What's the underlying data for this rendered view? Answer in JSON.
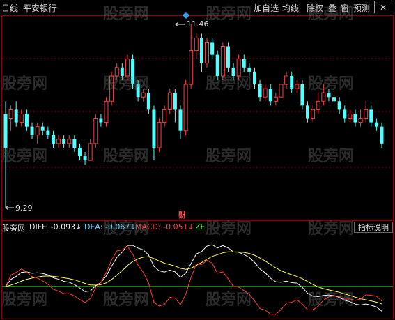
{
  "toolbar": {
    "period": "日线",
    "stock_name": "平安银行",
    "buttons": [
      "加自选",
      "均线",
      "除权",
      "叠",
      "窗",
      "预测"
    ]
  },
  "watermark": "股旁网",
  "chart": {
    "high_label": "11.46",
    "low_label": "9.29",
    "fin_marker": "财"
  },
  "macd": {
    "title": "股旁网",
    "diff": "DIFF: -0.093↓",
    "dea": "DEA: -0.067↓",
    "macd": "MACD: -0.051↓",
    "ze": "ZE",
    "help_label": "指标说明"
  },
  "colors": {
    "up": "#ff3c3c",
    "down": "#54ffff",
    "diff": "#ffffff",
    "dea": "#ffff54",
    "ze": "#ff3c3c",
    "zero": "#40ff40",
    "grid": "#8b0000"
  },
  "chart_data": {
    "type": "candlestick",
    "price_high": 11.46,
    "price_low": 9.29,
    "candles": [
      [
        10.4,
        10.0,
        10.55,
        9.29
      ],
      [
        10.35,
        10.45,
        10.5,
        10.2
      ],
      [
        10.45,
        10.3,
        10.55,
        10.25
      ],
      [
        10.3,
        10.4,
        10.45,
        10.25
      ],
      [
        10.4,
        10.25,
        10.45,
        10.2
      ],
      [
        10.25,
        10.15,
        10.3,
        10.1
      ],
      [
        10.15,
        10.25,
        10.3,
        10.05
      ],
      [
        10.25,
        10.2,
        10.3,
        10.15
      ],
      [
        10.2,
        10.15,
        10.25,
        10.1
      ],
      [
        10.15,
        10.05,
        10.2,
        10.0
      ],
      [
        10.05,
        10.1,
        10.15,
        10.0
      ],
      [
        10.1,
        10.05,
        10.15,
        10.0
      ],
      [
        10.05,
        10.1,
        10.15,
        10.0
      ],
      [
        10.1,
        10.0,
        10.15,
        9.95
      ],
      [
        10.0,
        9.9,
        10.05,
        9.85
      ],
      [
        9.9,
        9.85,
        9.95,
        9.8
      ],
      [
        9.85,
        10.05,
        10.1,
        9.85
      ],
      [
        10.05,
        10.35,
        10.4,
        10.0
      ],
      [
        10.35,
        10.3,
        10.4,
        10.25
      ],
      [
        10.3,
        10.55,
        10.6,
        10.25
      ],
      [
        10.55,
        10.85,
        10.9,
        10.5
      ],
      [
        10.85,
        10.95,
        11.0,
        10.8
      ],
      [
        10.95,
        10.85,
        11.0,
        10.8
      ],
      [
        10.85,
        11.05,
        11.1,
        10.8
      ],
      [
        11.05,
        10.75,
        11.1,
        10.7
      ],
      [
        10.75,
        10.6,
        10.8,
        10.55
      ],
      [
        10.6,
        10.65,
        10.7,
        10.55
      ],
      [
        10.65,
        10.45,
        10.7,
        10.4
      ],
      [
        10.45,
        10.0,
        10.5,
        9.85
      ],
      [
        10.0,
        10.3,
        10.35,
        9.95
      ],
      [
        10.3,
        10.45,
        10.5,
        10.25
      ],
      [
        10.45,
        10.65,
        10.7,
        10.4
      ],
      [
        10.65,
        10.45,
        10.7,
        10.3
      ],
      [
        10.45,
        10.2,
        10.5,
        10.1
      ],
      [
        10.2,
        10.75,
        10.8,
        10.15
      ],
      [
        10.75,
        11.15,
        11.46,
        10.7
      ],
      [
        11.15,
        11.3,
        11.35,
        11.05
      ],
      [
        11.3,
        11.0,
        11.35,
        10.9
      ],
      [
        11.0,
        11.25,
        11.3,
        10.95
      ],
      [
        11.25,
        11.1,
        11.3,
        11.05
      ],
      [
        11.1,
        10.85,
        11.15,
        10.8
      ],
      [
        10.85,
        11.2,
        11.25,
        10.8
      ],
      [
        11.2,
        10.95,
        11.25,
        10.9
      ],
      [
        10.95,
        10.85,
        11.0,
        10.8
      ],
      [
        10.85,
        11.05,
        11.1,
        10.8
      ],
      [
        11.05,
        10.95,
        11.1,
        10.9
      ],
      [
        10.95,
        10.9,
        11.0,
        10.85
      ],
      [
        10.9,
        10.75,
        10.95,
        10.7
      ],
      [
        10.75,
        10.6,
        10.8,
        10.55
      ],
      [
        10.6,
        10.7,
        10.75,
        10.55
      ],
      [
        10.7,
        10.55,
        10.75,
        10.5
      ],
      [
        10.55,
        10.6,
        10.65,
        10.5
      ],
      [
        10.6,
        10.75,
        10.8,
        10.55
      ],
      [
        10.75,
        10.85,
        10.9,
        10.7
      ],
      [
        10.85,
        10.7,
        10.9,
        10.65
      ],
      [
        10.7,
        10.75,
        10.8,
        10.65
      ],
      [
        10.75,
        10.5,
        10.8,
        10.45
      ],
      [
        10.5,
        10.35,
        10.55,
        10.3
      ],
      [
        10.35,
        10.45,
        10.5,
        10.3
      ],
      [
        10.45,
        10.55,
        10.65,
        10.4
      ],
      [
        10.55,
        10.65,
        10.75,
        10.5
      ],
      [
        10.65,
        10.6,
        10.7,
        10.55
      ],
      [
        10.6,
        10.55,
        10.65,
        10.5
      ],
      [
        10.55,
        10.45,
        10.6,
        10.4
      ],
      [
        10.45,
        10.35,
        10.5,
        10.3
      ],
      [
        10.35,
        10.4,
        10.45,
        10.3
      ],
      [
        10.4,
        10.3,
        10.45,
        10.25
      ],
      [
        10.3,
        10.35,
        10.45,
        10.25
      ],
      [
        10.35,
        10.45,
        10.55,
        10.3
      ],
      [
        10.45,
        10.3,
        10.5,
        10.25
      ],
      [
        10.3,
        10.25,
        10.35,
        10.2
      ],
      [
        10.25,
        10.05,
        10.3,
        10.0
      ]
    ]
  }
}
